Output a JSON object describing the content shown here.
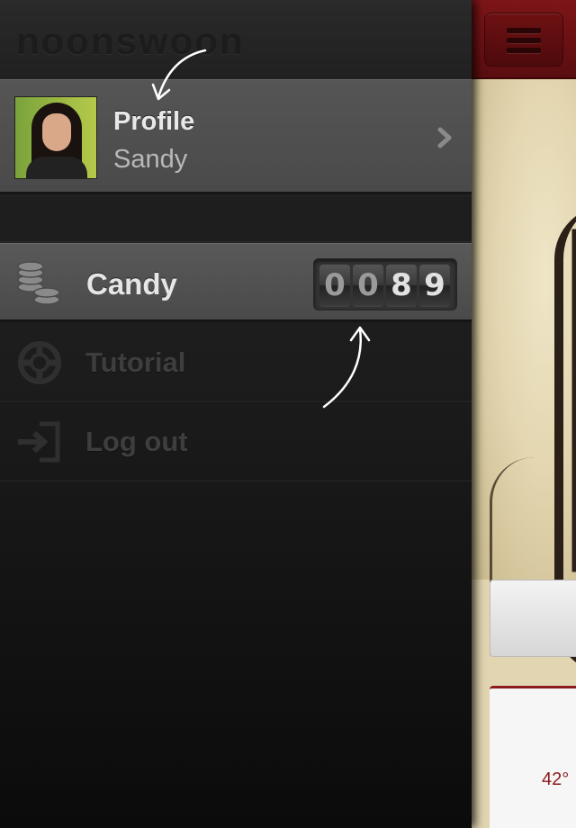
{
  "app": {
    "logo_text": "noonswoon"
  },
  "profile": {
    "title": "Profile",
    "name": "Sandy"
  },
  "candy": {
    "label": "Candy",
    "digits": [
      "0",
      "0",
      "8",
      "9"
    ]
  },
  "menu": {
    "items": [
      {
        "label": "Tutorial",
        "icon": "lifebuoy-icon"
      },
      {
        "label": "Log out",
        "icon": "logout-icon"
      }
    ]
  },
  "underlying": {
    "percent_text": "42°"
  },
  "colors": {
    "header_red": "#7d1517",
    "drawer_bg": "#1c1c1c",
    "row_highlight": "#4f4f4f"
  }
}
